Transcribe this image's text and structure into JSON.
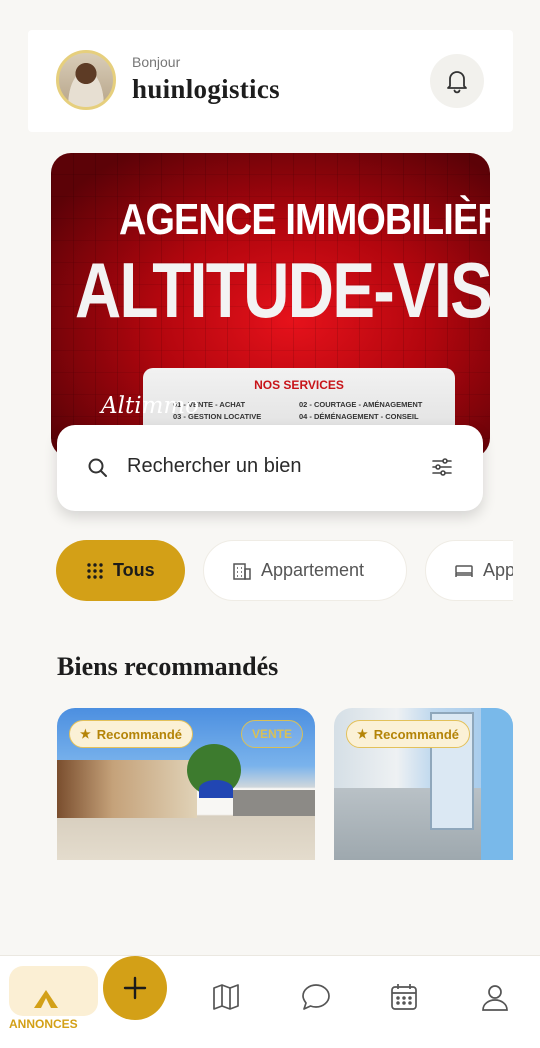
{
  "header": {
    "greeting": "Bonjour",
    "username": "huinlogistics",
    "avatar_icon": "user-avatar",
    "notification_icon": "bell-icon"
  },
  "banner": {
    "line1": "AGENCE IMMOBILIÈRE",
    "line2": "ALTITUDE-VISIO",
    "services_title": "NOS SERVICES",
    "services": [
      "01 - VENTE - ACHAT",
      "02 - COURTAGE - AMÉNAGEMENT",
      "03 - GESTION LOCATIVE",
      "04 - DÉMÉNAGEMENT - CONSEIL"
    ],
    "brand": "Altimmo"
  },
  "search": {
    "placeholder": "Rechercher un bien",
    "search_icon": "search-icon",
    "filter_icon": "filter-icon"
  },
  "categories": [
    {
      "label": "Tous",
      "icon": "grid-icon",
      "active": true
    },
    {
      "label": "Appartement",
      "icon": "building-icon",
      "active": false
    },
    {
      "label": "App",
      "icon": "bed-icon",
      "active": false
    }
  ],
  "section": {
    "title": "Biens recommandés"
  },
  "properties": [
    {
      "badge": "Recommandé",
      "status": "VENTE"
    },
    {
      "badge": "Recommandé",
      "status": ""
    }
  ],
  "nav": {
    "home_label": "ANNONCES",
    "items": [
      "home-icon",
      "add-icon",
      "map-icon",
      "chat-icon",
      "calendar-icon",
      "profile-icon"
    ]
  },
  "colors": {
    "accent": "#d3a017",
    "background": "#f8f7f4",
    "badge_bg": "#fbf1d6"
  }
}
